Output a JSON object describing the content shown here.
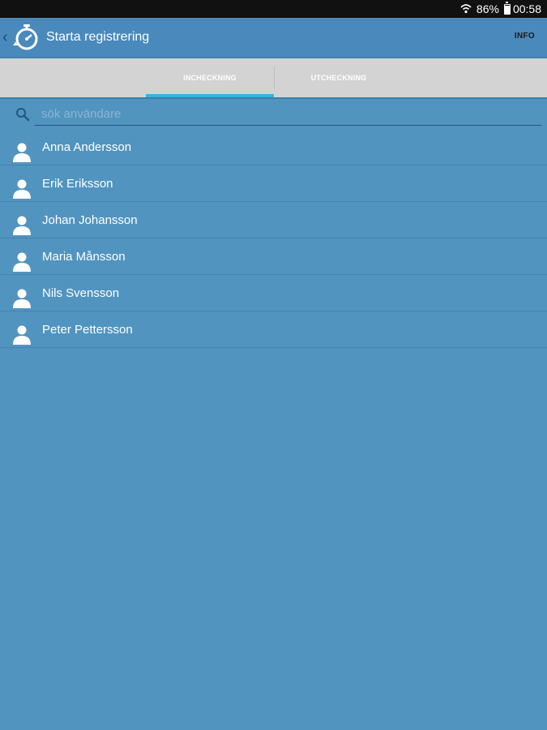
{
  "status": {
    "battery": "86%",
    "time": "00:58"
  },
  "appbar": {
    "back": "‹",
    "title": "Starta registrering",
    "info": "INFO"
  },
  "tabs": [
    {
      "label": "INCHECKNING",
      "selected": true
    },
    {
      "label": "UTCHECKNING",
      "selected": false
    }
  ],
  "search": {
    "placeholder": "sök användare",
    "value": ""
  },
  "users": [
    {
      "name": "Anna Andersson"
    },
    {
      "name": "Erik Eriksson"
    },
    {
      "name": "Johan Johansson"
    },
    {
      "name": "Maria Månsson"
    },
    {
      "name": "Nils Svensson"
    },
    {
      "name": "Peter Pettersson"
    }
  ],
  "colors": {
    "background": "#5194bf",
    "appbar": "#4a89bb",
    "tab_indicator": "#33b4e3",
    "tabs_bg": "#d3d3d3"
  },
  "icons": {
    "app": "stopwatch-icon",
    "search": "search-icon",
    "user": "person-icon",
    "wifi": "wifi-icon",
    "battery": "battery-icon"
  }
}
